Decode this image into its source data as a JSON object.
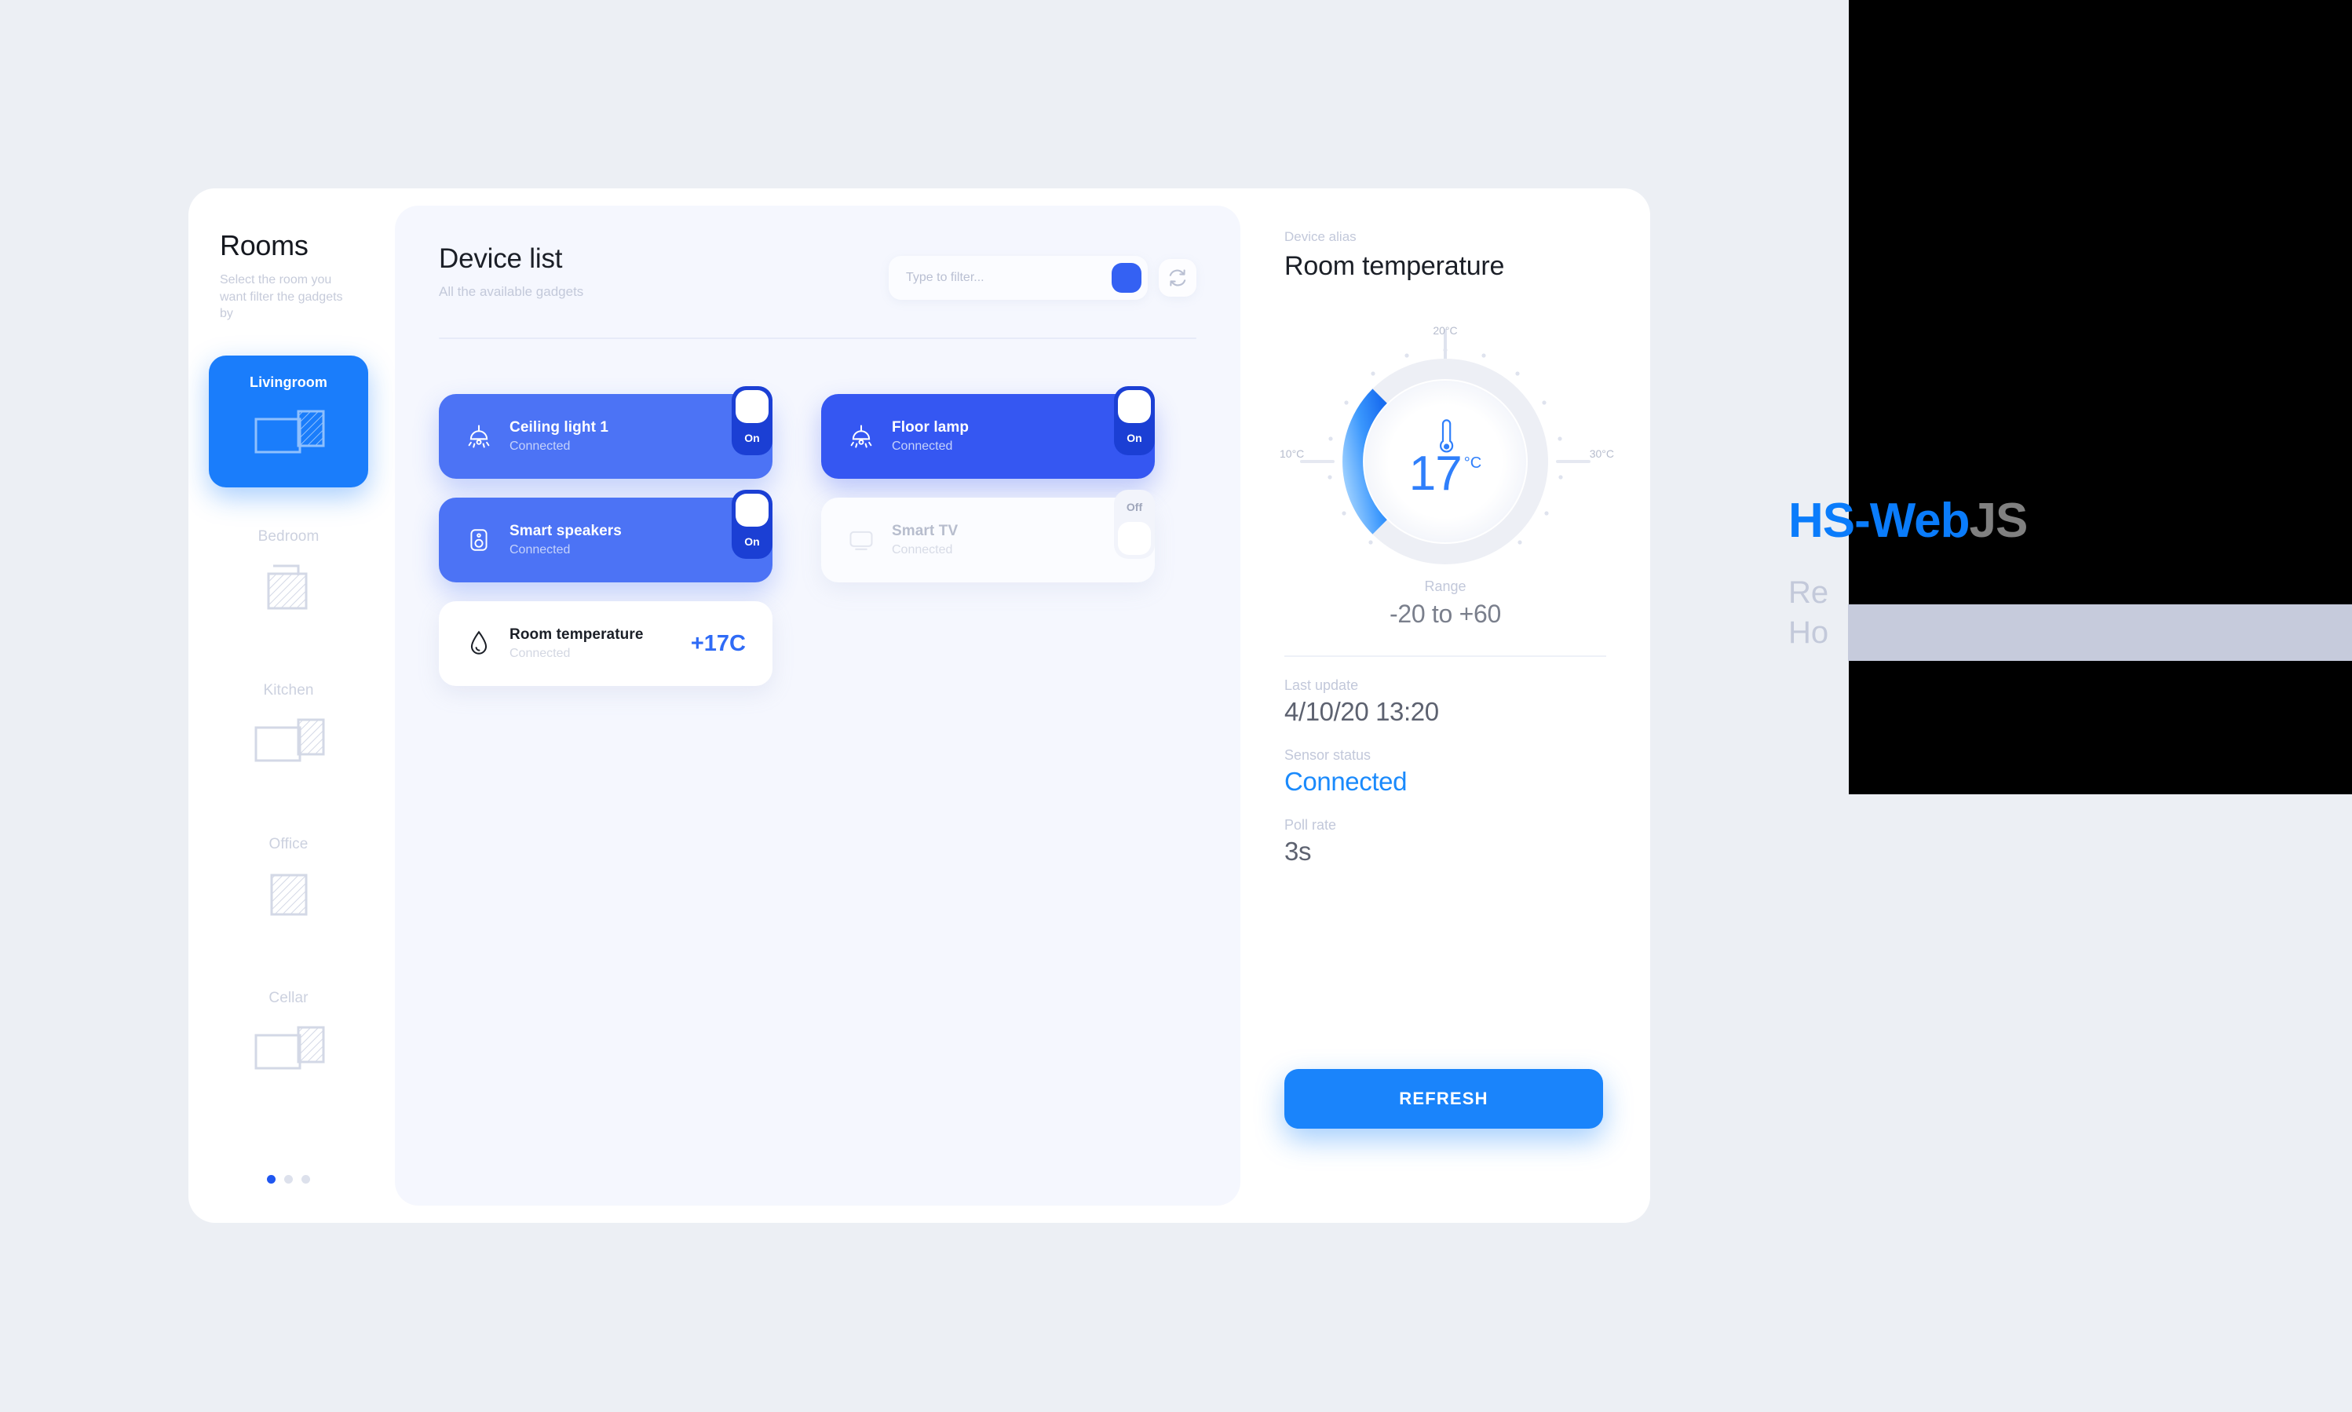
{
  "sidebar": {
    "title": "Rooms",
    "subtitle": "Select the room you want filter the gadgets by",
    "rooms": [
      {
        "label": "Livingroom",
        "icon": "floorplan-livingroom-icon",
        "active": true
      },
      {
        "label": "Bedroom",
        "icon": "floorplan-bedroom-icon",
        "active": false
      },
      {
        "label": "Kitchen",
        "icon": "floorplan-kitchen-icon",
        "active": false
      },
      {
        "label": "Office",
        "icon": "floorplan-office-icon",
        "active": false
      },
      {
        "label": "Cellar",
        "icon": "floorplan-cellar-icon",
        "active": false
      }
    ],
    "pager": {
      "count": 3,
      "active_index": 0
    }
  },
  "devices_panel": {
    "title": "Device list",
    "subtitle": "All the available gadgets",
    "filter": {
      "value": "",
      "placeholder": "Type to filter..."
    },
    "submit_icon": "filter-submit-icon",
    "refresh_icon": "refresh-icon",
    "cards": [
      {
        "name": "Ceiling light 1",
        "status": "Connected",
        "icon": "ceiling-light-icon",
        "state": "On",
        "value": ""
      },
      {
        "name": "Floor lamp",
        "status": "Connected",
        "icon": "floor-lamp-icon",
        "state": "On",
        "value": ""
      },
      {
        "name": "Smart speakers",
        "status": "Connected",
        "icon": "speaker-icon",
        "state": "On",
        "value": ""
      },
      {
        "name": "Smart TV",
        "status": "Connected",
        "icon": "tv-icon",
        "state": "Off",
        "value": ""
      },
      {
        "name": "Room temperature",
        "status": "Connected",
        "icon": "water-drop-icon",
        "state": "",
        "value": "+17C"
      }
    ]
  },
  "detail": {
    "alias_label": "Device alias",
    "alias_value": "Room temperature",
    "range_label": "Range",
    "range_value": "-20 to +60",
    "rows": [
      {
        "label": "Last update",
        "value": "4/10/20 13:20",
        "accent": false
      },
      {
        "label": "Sensor status",
        "value": "Connected",
        "accent": true
      },
      {
        "label": "Poll rate",
        "value": "3s",
        "accent": false
      }
    ],
    "refresh_label": "REFRESH"
  },
  "overlay": {
    "brand_primary": "HS-Web",
    "brand_secondary": "JS",
    "tagline_line1": "Re",
    "tagline_line2": "Ho"
  },
  "colors": {
    "accent_blue": "#1a7dfb",
    "card_on_light": "#4c73f5",
    "card_on_dark": "#3557f2",
    "toggle_on": "#1b3fd4",
    "muted": "#c2c8da",
    "status_blue": "#1a8afc",
    "temp_blue": "#2f6bf6"
  },
  "chart_data": {
    "type": "gauge",
    "title": "Room temperature",
    "value": 17,
    "unit": "°C",
    "display_value": "17",
    "display_unit": "°C",
    "axis_ticks": [
      "10°C",
      "20°C",
      "30°C"
    ],
    "tick_positions": [
      "left",
      "top",
      "right"
    ],
    "gauge_min": 10,
    "gauge_max": 30,
    "sweep_start_deg": 135,
    "sweep_end_deg": 405,
    "filled_fraction": 0.43,
    "range_min": -20,
    "range_max": 60,
    "center_icon": "thermometer-icon",
    "arc_color_start": "#1a7dfb",
    "arc_color_end": "#7cc0ff",
    "track_color": "#eceef4"
  }
}
